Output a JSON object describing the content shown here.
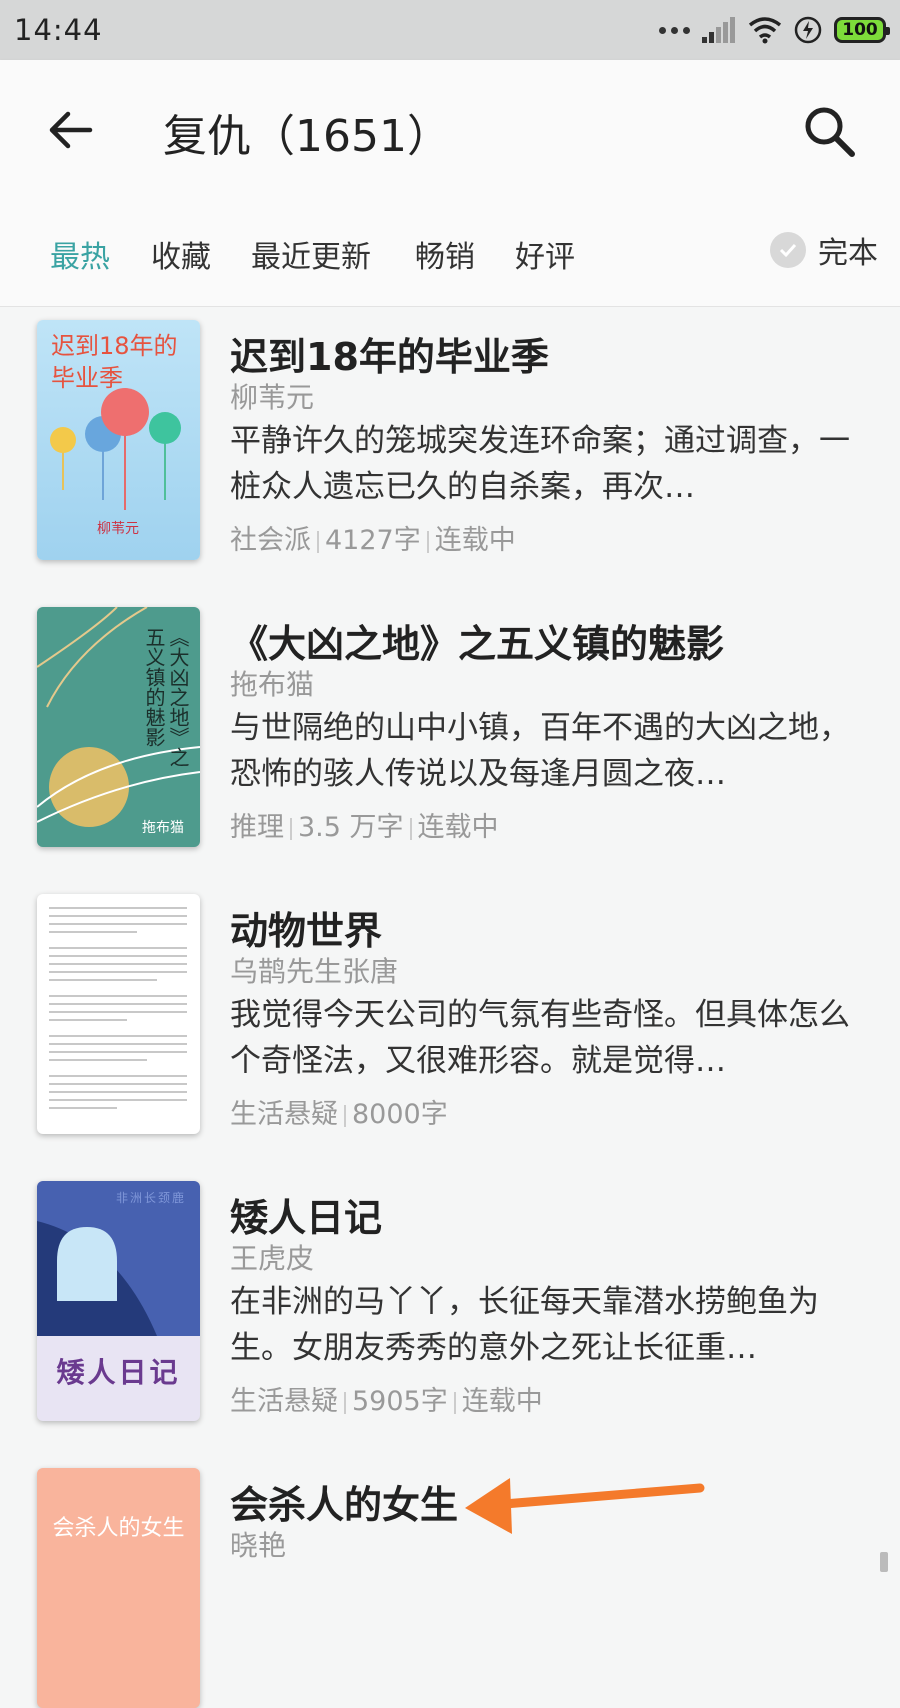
{
  "status": {
    "time": "14:44",
    "battery": "100"
  },
  "header": {
    "title": "复仇（1651）"
  },
  "filters": {
    "tabs": [
      {
        "label": "最热"
      },
      {
        "label": "收藏"
      },
      {
        "label": "最近更新"
      },
      {
        "label": "畅销"
      },
      {
        "label": "好评"
      }
    ],
    "finished_label": "完本"
  },
  "books": [
    {
      "title": "迟到18年的毕业季",
      "author": "柳苇元",
      "desc": "平静许久的笼城突发连环命案；通过调查，一桩众人遗忘已久的自杀案，再次…",
      "genre": "社会派",
      "words": "4127字",
      "status": "连载中",
      "cover_text": "迟到18年的毕业季",
      "cover_author": "柳苇元"
    },
    {
      "title": "《大凶之地》之五义镇的魅影",
      "author": "拖布猫",
      "desc": "与世隔绝的山中小镇，百年不遇的大凶之地，恐怖的骇人传说以及每逢月圆之夜…",
      "genre": "推理",
      "words": "3.5 万字",
      "status": "连载中",
      "cover_text": "《大凶之地》之五义镇的魅影",
      "cover_author": "拖布猫"
    },
    {
      "title": "动物世界",
      "author": "乌鹊先生张唐",
      "desc": "我觉得今天公司的气氛有些奇怪。但具体怎么个奇怪法，又很难形容。就是觉得…",
      "genre": "生活悬疑",
      "words": "8000字",
      "status": ""
    },
    {
      "title": "矮人日记",
      "author": "王虎皮",
      "desc": "在非洲的马丫丫，长征每天靠潜水捞鲍鱼为生。女朋友秀秀的意外之死让长征重…",
      "genre": "生活悬疑",
      "words": "5905字",
      "status": "连载中",
      "cover_text": "矮人日记",
      "cover_author": "非洲长颈鹿"
    },
    {
      "title": "会杀人的女生",
      "author": "晓艳",
      "desc": "",
      "genre": "",
      "words": "",
      "status": "",
      "cover_text": "会杀人的女生"
    }
  ],
  "colors": {
    "accent": "#3aa3a3",
    "annotation_arrow": "#f47a2b"
  }
}
